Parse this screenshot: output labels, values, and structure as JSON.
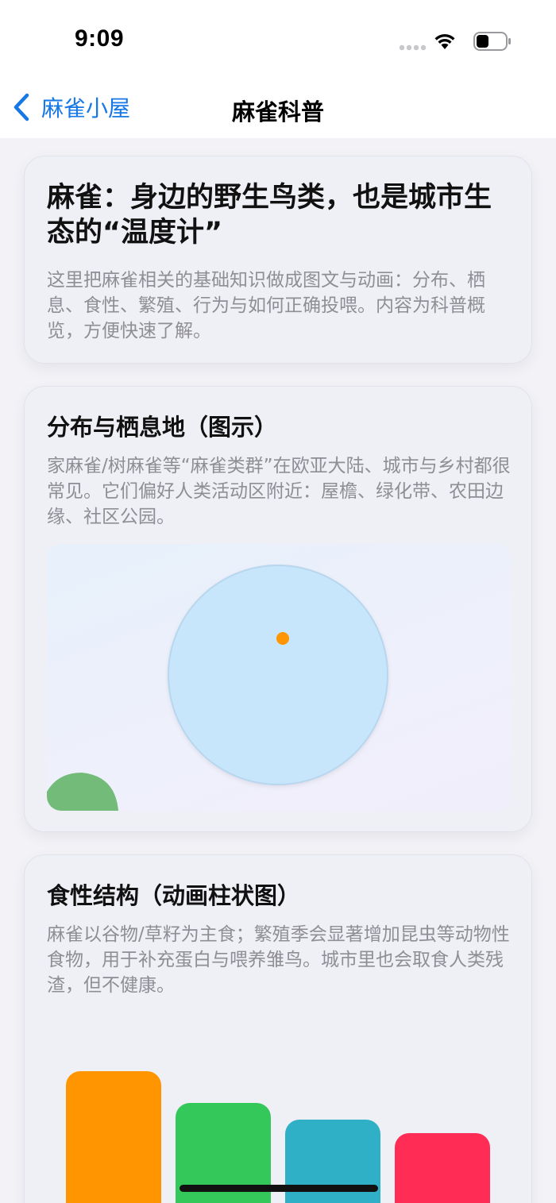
{
  "status_bar": {
    "time": "9:09",
    "icons": [
      "signal-icon",
      "wifi-icon",
      "battery-icon"
    ]
  },
  "nav": {
    "back_label": "麻雀小屋",
    "title": "麻雀科普",
    "accent_color": "#1677e6"
  },
  "intro": {
    "title": "麻雀：身边的野生鸟类，也是城市生态的“温度计”",
    "text": "这里把麻雀相关的基础知识做成图文与动画：分布、栖息、食性、繁殖、行为与如何正确投喂。内容为科普概览，方便快速了解。"
  },
  "habitat": {
    "title": "分布与栖息地（图示）",
    "text": "家麻雀/树麻雀等“麻雀类群”在欧亚大陆、城市与乡村都很常见。它们偏好人类活动区附近：屋檐、绿化带、农田边缘、社区公园。",
    "illustration": {
      "globe_color": "#c8e6fb",
      "marker_color": "#ff9500",
      "leaf_color": "#72bb78"
    }
  },
  "diet": {
    "title": "食性结构（动画柱状图）",
    "text": "麻雀以谷物/草籽为主食；繁殖季会显著增加昆虫等动物性食物，用于补充蛋白与喂养雏鸟。城市里也会取食人类残渣，但不健康。",
    "chart_data": {
      "type": "bar",
      "series": [
        {
          "values": [
            1.0,
            0.76,
            0.63,
            0.53
          ]
        }
      ],
      "colors": [
        "#ff9500",
        "#34c759",
        "#30b0c7",
        "#ff2d55"
      ]
    }
  }
}
